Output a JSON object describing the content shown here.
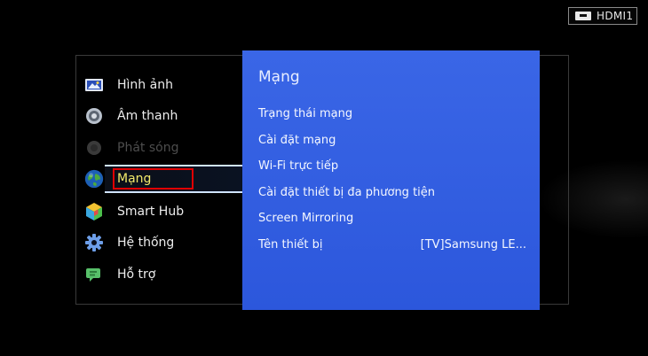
{
  "source": {
    "label": "HDMI1"
  },
  "menu": {
    "items": [
      {
        "label": "Hình ảnh",
        "icon": "picture-icon",
        "state": "normal"
      },
      {
        "label": "Âm thanh",
        "icon": "sound-icon",
        "state": "normal"
      },
      {
        "label": "Phát sóng",
        "icon": "broadcast-icon",
        "state": "disabled"
      },
      {
        "label": "Mạng",
        "icon": "globe-icon",
        "state": "active"
      },
      {
        "label": "Smart Hub",
        "icon": "smart-hub-cube-icon",
        "state": "normal"
      },
      {
        "label": "Hệ thống",
        "icon": "gear-icon",
        "state": "normal"
      },
      {
        "label": "Hỗ trợ",
        "icon": "support-icon",
        "state": "normal"
      }
    ]
  },
  "submenu": {
    "title": "Mạng",
    "items": [
      {
        "label": "Trạng thái mạng",
        "value": ""
      },
      {
        "label": "Cài đặt mạng",
        "value": ""
      },
      {
        "label": "Wi-Fi trực tiếp",
        "value": ""
      },
      {
        "label": "Cài đặt thiết bị đa phương tiện",
        "value": ""
      },
      {
        "label": "Screen Mirroring",
        "value": ""
      },
      {
        "label": "Tên thiết bị",
        "value": "[TV]Samsung LE..."
      }
    ]
  },
  "colors": {
    "panel_blue": "#2f5be0",
    "active_text": "#f2e96a",
    "highlight_red": "#e00000"
  }
}
